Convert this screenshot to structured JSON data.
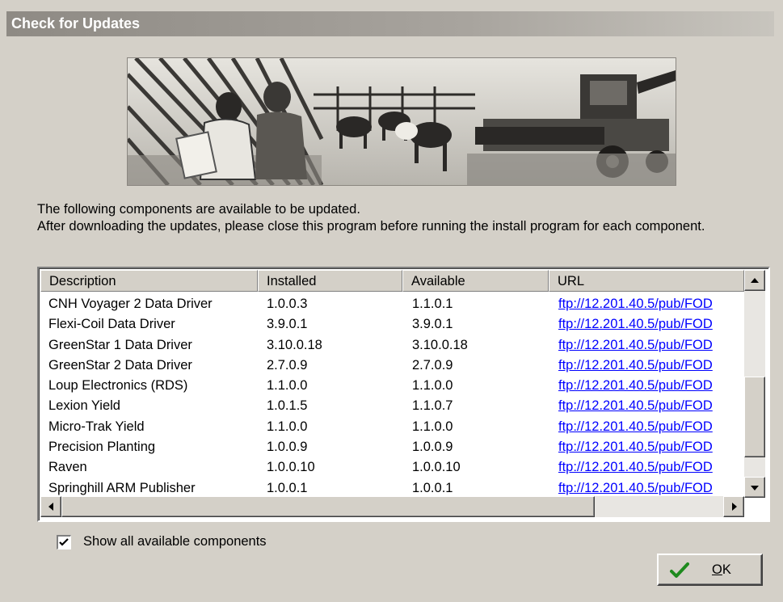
{
  "window": {
    "title": "Check for Updates"
  },
  "info": {
    "line1": "The following components are available to be updated.",
    "line2": "After downloading the updates, please close this program before running the install program for each component."
  },
  "table": {
    "columns": [
      "Description",
      "Installed",
      "Available",
      "URL"
    ],
    "rows": [
      {
        "description": "CNH Voyager 2 Data Driver",
        "installed": "1.0.0.3",
        "available": "1.1.0.1",
        "url": "ftp://12.201.40.5/pub/FOD"
      },
      {
        "description": "Flexi-Coil Data Driver",
        "installed": "3.9.0.1",
        "available": "3.9.0.1",
        "url": "ftp://12.201.40.5/pub/FOD"
      },
      {
        "description": "GreenStar 1 Data Driver",
        "installed": "3.10.0.18",
        "available": "3.10.0.18",
        "url": "ftp://12.201.40.5/pub/FOD"
      },
      {
        "description": "GreenStar 2 Data Driver",
        "installed": "2.7.0.9",
        "available": "2.7.0.9",
        "url": "ftp://12.201.40.5/pub/FOD"
      },
      {
        "description": "Loup Electronics (RDS)",
        "installed": "1.1.0.0",
        "available": "1.1.0.0",
        "url": "ftp://12.201.40.5/pub/FOD"
      },
      {
        "description": "Lexion Yield",
        "installed": "1.0.1.5",
        "available": "1.1.0.7",
        "url": "ftp://12.201.40.5/pub/FOD"
      },
      {
        "description": "Micro-Trak Yield",
        "installed": "1.1.0.0",
        "available": "1.1.0.0",
        "url": "ftp://12.201.40.5/pub/FOD"
      },
      {
        "description": "Precision Planting",
        "installed": "1.0.0.9",
        "available": "1.0.0.9",
        "url": "ftp://12.201.40.5/pub/FOD"
      },
      {
        "description": "Raven",
        "installed": "1.0.0.10",
        "available": "1.0.0.10",
        "url": "ftp://12.201.40.5/pub/FOD"
      },
      {
        "description": "Springhill ARM Publisher",
        "installed": "1.0.0.1",
        "available": "1.0.0.1",
        "url": "ftp://12.201.40.5/pub/FOD"
      }
    ]
  },
  "options": {
    "show_all_label": "Show all available components",
    "show_all_checked": true
  },
  "buttons": {
    "ok_label": "OK",
    "ok_accel": "O",
    "ok_rest": "K"
  }
}
